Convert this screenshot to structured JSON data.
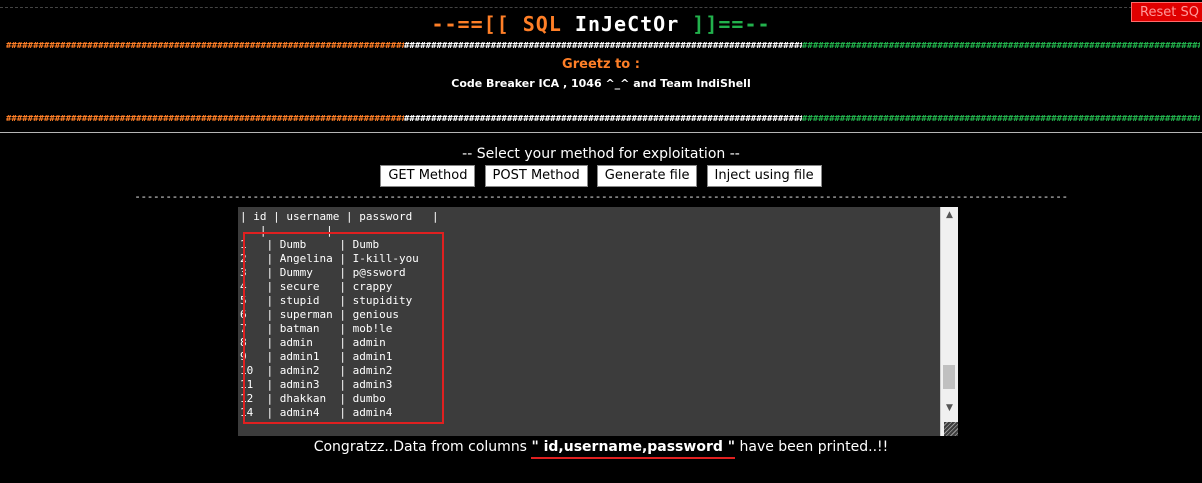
{
  "reset_button": "Reset SQ",
  "title": {
    "prefix": "--==[[ ",
    "sql": "SQL",
    "injector": " InJeCtOr",
    "suffix": " ]]==--"
  },
  "hash_line": "################################################################################################################################",
  "greetz_label": "Greetz to :",
  "credits": "Code Breaker ICA , 1046 ^_^ and Team IndiShell",
  "select_method_label": "-- Select your method for exploitation --",
  "buttons": {
    "get": "GET Method",
    "post": "POST Method",
    "generate": "Generate file",
    "inject": "Inject using file"
  },
  "dash_line": "------------------------------------------------------------------------------------------------------------------------------------------------------",
  "output_text": "| id | username | password   |\n   |         |         \n1   | Dumb     | Dumb\n2   | Angelina | I-kill-you\n3   | Dummy    | p@ssword\n4   | secure   | crappy\n5   | stupid   | stupidity\n6   | superman | genious\n7   | batman   | mob!le\n8   | admin    | admin\n9   | admin1   | admin1\n10  | admin2   | admin2\n11  | admin3   | admin3\n12  | dhakkan  | dumbo\n14  | admin4   | admin4",
  "congrats": {
    "prefix": "Congratzz..Data from columns ",
    "columns": "\" id,username,password \"",
    "suffix": " have been printed..!!"
  },
  "colors": {
    "orange": "#ff7f27",
    "white": "#ffffff",
    "green": "#22b14c",
    "reset_red": "#e00000",
    "highlight_red": "#e02020"
  }
}
